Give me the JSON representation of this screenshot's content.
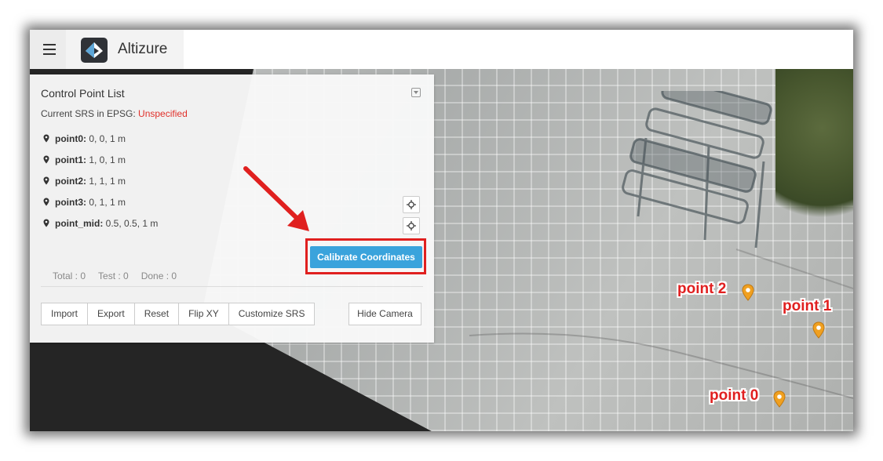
{
  "app": {
    "brand_name": "Altizure"
  },
  "panel": {
    "title": "Control Point List",
    "srs_label": "Current SRS in EPSG: ",
    "srs_value": "Unspecified",
    "points": [
      {
        "name": "point0:",
        "value": " 0, 0, 1 m"
      },
      {
        "name": "point1:",
        "value": " 1, 0, 1 m"
      },
      {
        "name": "point2:",
        "value": " 1, 1, 1 m"
      },
      {
        "name": "point3:",
        "value": " 0, 1, 1 m"
      },
      {
        "name": "point_mid:",
        "value": " 0.5, 0.5, 1 m"
      }
    ],
    "calibrate_label": "Calibrate Coordinates",
    "stats": {
      "total": "Total : 0",
      "test": "Test : 0",
      "done": "Done : 0"
    },
    "buttons": {
      "import": "Import",
      "export": "Export",
      "reset": "Reset",
      "flip_xy": "Flip XY",
      "customize_srs": "Customize SRS",
      "hide_camera": "Hide Camera"
    }
  },
  "map": {
    "labels": {
      "point2": "point 2",
      "point1": "point 1",
      "point0": "point 0"
    }
  },
  "colors": {
    "accent": "#3aa3dc",
    "srs_unspecified": "#e0302a",
    "annotation_red": "#e0201f",
    "marker": "#f0a020"
  }
}
